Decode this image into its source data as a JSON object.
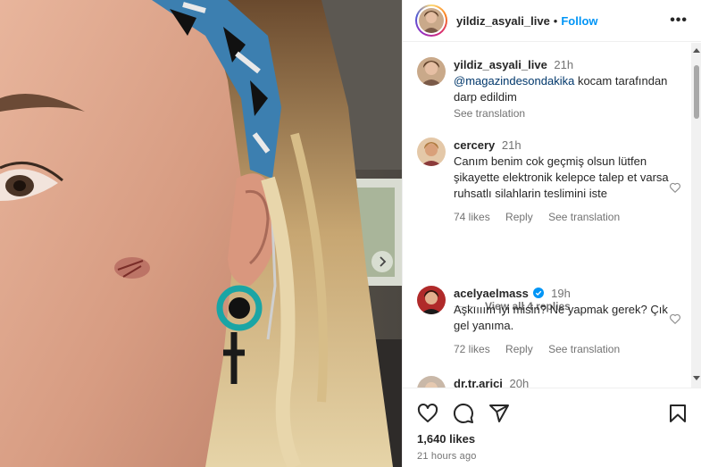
{
  "post": {
    "username": "yildiz_asyali_live",
    "follow_label": "Follow",
    "separator": "•",
    "more_label": "•••",
    "likes": "1,640 likes",
    "time_ago": "21 hours ago"
  },
  "caption": {
    "username": "yildiz_asyali_live",
    "time": "21h",
    "mention": "@magazindesondakika",
    "text": " kocam tarafından darp edildim",
    "see_translation": "See translation"
  },
  "comments": [
    {
      "username": "cercery",
      "time": "21h",
      "text": "Canım benim cok geçmiş olsun lütfen şikayette elektronik kelepce talep et varsa ruhsatlı silahlarin teslimini iste",
      "likes": "74 likes",
      "reply": "Reply",
      "see_translation": "See translation",
      "view_replies": "View all 4 replies",
      "avatar_color": "#d9b08c"
    },
    {
      "username": "acelyaelmass",
      "time": "19h",
      "text": "Aşkıııım iyi misin? Ne yapmak gerek? Çık gel yanıma.",
      "likes": "72 likes",
      "reply": "Reply",
      "see_translation": "See translation",
      "verified": true,
      "avatar_color": "#c0392b"
    },
    {
      "username": "dr.tr.arici",
      "time": "20h",
      "avatar_color": "#c9b8a8"
    }
  ],
  "icons": [
    "heart-icon",
    "comment-icon",
    "share-icon",
    "bookmark-icon",
    "more-icon",
    "chevron-right-icon",
    "verified-icon"
  ],
  "colors": {
    "link": "#0095f6",
    "mention": "#00376b",
    "muted": "#737373",
    "verified": "#0095f6"
  }
}
